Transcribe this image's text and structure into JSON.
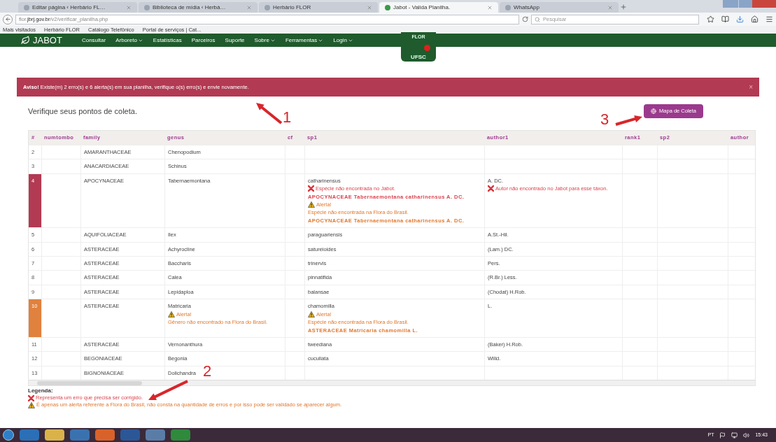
{
  "browser": {
    "tabs": [
      {
        "title": "Editar página ‹ Herbário FL…",
        "selected": false
      },
      {
        "title": "Biblioteca de mídia ‹ Herbá…",
        "selected": false
      },
      {
        "title": "Herbário FLOR",
        "selected": false
      },
      {
        "title": "Jabot - Valida Planilha.",
        "selected": true
      },
      {
        "title": "WhatsApp",
        "selected": false
      }
    ],
    "address": {
      "prefix": "flor.",
      "domain": "jbrj.gov.br",
      "path": "/v2/verificar_planilha.php"
    },
    "search_placeholder": "Pesquisar",
    "bookmarks": [
      "Mais visitados",
      "Herbário FLOR",
      "Catálogo Telefônico",
      "Portal de serviços | Cat..."
    ]
  },
  "nav": {
    "brand": "JABOT",
    "items": [
      {
        "label": "Consultar",
        "dropdown": false
      },
      {
        "label": "Arboreto",
        "dropdown": true
      },
      {
        "label": "Estatísticas",
        "dropdown": false
      },
      {
        "label": "Parceiros",
        "dropdown": false
      },
      {
        "label": "Suporte",
        "dropdown": false
      },
      {
        "label": "Sobre",
        "dropdown": true
      },
      {
        "label": "Ferramentas",
        "dropdown": true
      },
      {
        "label": "Login",
        "dropdown": true
      }
    ],
    "logo_texts": [
      "FLOR",
      "UFSC"
    ]
  },
  "alert": {
    "strong": "Aviso!",
    "message": "Existe(m) 2 erro(s) e 6 alerta(s) em sua planilha, verifique o(s) erro(s) e envie novamente.",
    "close": "×"
  },
  "heading": "Verifique seus pontos de coleta.",
  "map_button": "Mapa de Coleta",
  "table": {
    "columns": [
      "#",
      "numtombo",
      "family",
      "genus",
      "cf",
      "sp1",
      "author1",
      "rank1",
      "sp2",
      "author"
    ],
    "rows": [
      {
        "n": "2",
        "family": "AMARANTHACEAE",
        "genus": [
          {
            "kind": "text",
            "text": "Chenopodium"
          }
        ],
        "sp1": [],
        "author1": []
      },
      {
        "n": "3",
        "family": "ANACARDIACEAE",
        "genus": [
          {
            "kind": "text",
            "text": "Schinus"
          }
        ],
        "sp1": [],
        "author1": []
      },
      {
        "color": "#b23a52",
        "n": "4",
        "family": "APOCYNACEAE",
        "genus": [
          {
            "kind": "text",
            "text": "Tabernaemontana"
          }
        ],
        "sp1": [
          {
            "kind": "text",
            "text": "catharinensus"
          },
          {
            "kind": "error",
            "text": "Espécie não encontrada no Jabot."
          },
          {
            "kind": "error-ref",
            "text": "APOCYNACEAE Tabernaemontana catharinensus A. DC."
          },
          {
            "kind": "alert",
            "text": "Alerta!"
          },
          {
            "kind": "alert-note",
            "text": "Espécie não encontrada na Flora do Brasil."
          },
          {
            "kind": "alert-ref",
            "text": "APOCYNACEAE Tabernaemontana catharinensus A. DC."
          }
        ],
        "author1": [
          {
            "kind": "text",
            "text": "A. DC."
          },
          {
            "kind": "error",
            "text": "Autor não encontrado no Jabot para esse táxon."
          }
        ]
      },
      {
        "n": "5",
        "family": "AQUIFOLIACEAE",
        "genus": [
          {
            "kind": "text",
            "text": "Ilex"
          }
        ],
        "sp1": [
          {
            "kind": "text",
            "text": "paraguariensis"
          }
        ],
        "author1": [
          {
            "kind": "text",
            "text": "A.St.-Hil."
          }
        ]
      },
      {
        "n": "6",
        "family": "ASTERACEAE",
        "genus": [
          {
            "kind": "text",
            "text": "Achyrocline"
          }
        ],
        "sp1": [
          {
            "kind": "text",
            "text": "satureioides"
          }
        ],
        "author1": [
          {
            "kind": "text",
            "text": "(Lam.) DC."
          }
        ]
      },
      {
        "n": "7",
        "family": "ASTERACEAE",
        "genus": [
          {
            "kind": "text",
            "text": "Baccharis"
          }
        ],
        "sp1": [
          {
            "kind": "text",
            "text": "trinervis"
          }
        ],
        "author1": [
          {
            "kind": "text",
            "text": "Pers."
          }
        ]
      },
      {
        "n": "8",
        "family": "ASTERACEAE",
        "genus": [
          {
            "kind": "text",
            "text": "Calea"
          }
        ],
        "sp1": [
          {
            "kind": "text",
            "text": "pinnatifida"
          }
        ],
        "author1": [
          {
            "kind": "text",
            "text": "(R.Br.) Less."
          }
        ]
      },
      {
        "n": "9",
        "family": "ASTERACEAE",
        "genus": [
          {
            "kind": "text",
            "text": "Lepidaploa"
          }
        ],
        "sp1": [
          {
            "kind": "text",
            "text": "balansae"
          }
        ],
        "author1": [
          {
            "kind": "text",
            "text": "(Chodat) H.Rob."
          }
        ]
      },
      {
        "color": "#e0813e",
        "n": "10",
        "family": "ASTERACEAE",
        "genus": [
          {
            "kind": "text",
            "text": "Matricaria"
          },
          {
            "kind": "alert",
            "text": "Alerta!"
          },
          {
            "kind": "alert-note",
            "text": "Gênero não encontrado na Flora do Brasil."
          }
        ],
        "sp1": [
          {
            "kind": "text",
            "text": "chamomilla"
          },
          {
            "kind": "alert",
            "text": "Alerta!"
          },
          {
            "kind": "alert-note",
            "text": "Espécie não encontrada na Flora do Brasil."
          },
          {
            "kind": "alert-ref",
            "text": "ASTERACEAE Matricaria chamomilla L."
          }
        ],
        "author1": [
          {
            "kind": "text",
            "text": "L."
          }
        ]
      },
      {
        "n": "11",
        "family": "ASTERACEAE",
        "genus": [
          {
            "kind": "text",
            "text": "Vernonanthura"
          }
        ],
        "sp1": [
          {
            "kind": "text",
            "text": "tweediana"
          }
        ],
        "author1": [
          {
            "kind": "text",
            "text": "(Baker) H.Rob."
          }
        ]
      },
      {
        "n": "12",
        "family": "BEGONIACEAE",
        "genus": [
          {
            "kind": "text",
            "text": "Begonia"
          }
        ],
        "sp1": [
          {
            "kind": "text",
            "text": "cucullata"
          }
        ],
        "author1": [
          {
            "kind": "text",
            "text": "Willd."
          }
        ]
      },
      {
        "n": "13",
        "family": "BIGNONIACEAE",
        "genus": [
          {
            "kind": "text",
            "text": "Dolichandra"
          }
        ],
        "sp1": [],
        "author1": []
      }
    ]
  },
  "legend": {
    "title": "Legenda:",
    "items": [
      {
        "kind": "error",
        "text": "Representa um erro que precisa ser corrigido."
      },
      {
        "kind": "alert",
        "text": "É apenas um alerta referente a Flora do Brasil, não consta na quantidade de erros e por isso pode ser validado se aparecer algum."
      }
    ]
  },
  "annotations": [
    "1",
    "2",
    "3"
  ],
  "taskbar": {
    "language": "PT",
    "time": "15:43"
  }
}
